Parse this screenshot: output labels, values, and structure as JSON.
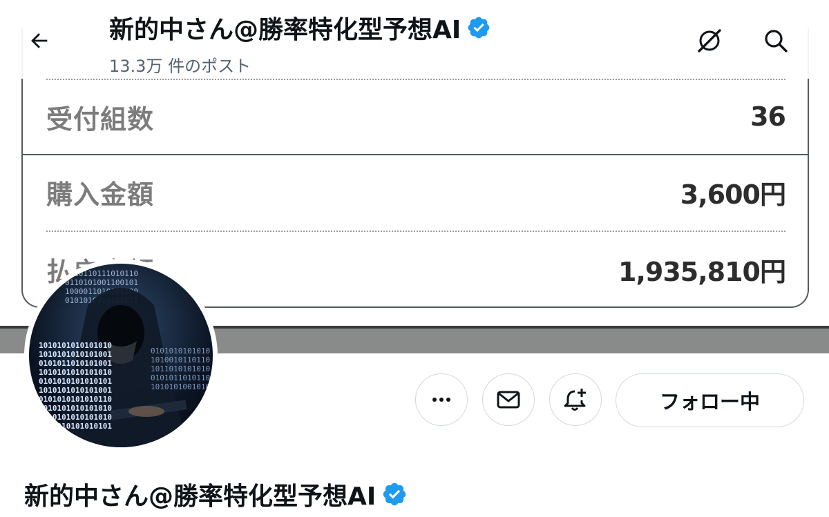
{
  "header": {
    "title": "新的中さん@勝率特化型予想AI",
    "post_count": "13.3万 件のポスト"
  },
  "banner": {
    "rows": [
      {
        "label": "受付組数",
        "value": "36"
      },
      {
        "label": "購入金額",
        "value": "3,600円"
      },
      {
        "label": "払戻金額",
        "value": "1,935,810円"
      }
    ]
  },
  "avatar": {
    "binary_left": "1010101010101010\n1010101010101001\n0101011010101001\n1010101010101010\n0101010101010101\n1010101010101001\n0101010101010110\n1010101010101010\n1010101010101010\n0101010101010101",
    "binary_top": "1010110111010110\n0110101001100101\n1000011010101100\n0101010010101011",
    "binary_right": "0101010101010\n1010010110110\n1011010101010\n0101011010110\n1010101001010"
  },
  "actions": {
    "follow_label": "フォロー中"
  },
  "profile": {
    "name": "新的中さん@勝率特化型予想AI"
  },
  "colors": {
    "verified": "#1d9bf0",
    "text_primary": "#0f1419",
    "text_secondary": "#536471",
    "border": "#cfd9de"
  },
  "icons": {
    "back": "arrow-left-icon",
    "grok": "grok-icon",
    "search": "search-icon",
    "more": "more-horizontal-icon",
    "mail": "mail-icon",
    "notify": "bell-plus-icon",
    "verified": "verified-badge-icon"
  }
}
